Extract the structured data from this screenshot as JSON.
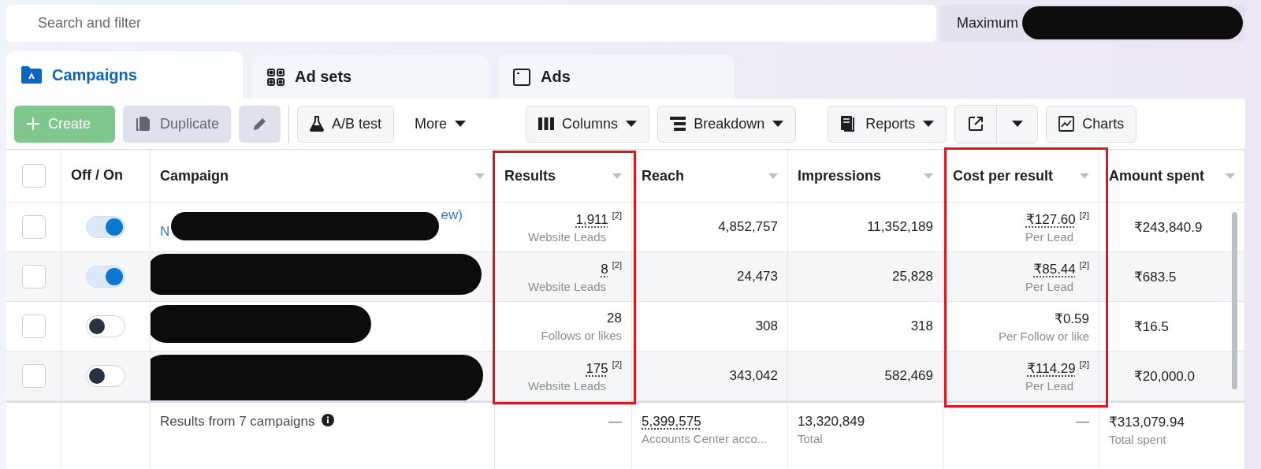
{
  "search": {
    "placeholder": "Search and filter"
  },
  "filter": {
    "label": "Maximum"
  },
  "tabs": [
    {
      "label": "Campaigns",
      "selected": true
    },
    {
      "label": "Ad sets",
      "selected": false
    },
    {
      "label": "Ads",
      "selected": false
    }
  ],
  "toolbar": [
    {
      "kind": "create",
      "label": "Create",
      "disabled": true
    },
    {
      "kind": "duplicate",
      "label": "Duplicate",
      "disabled": true
    },
    {
      "kind": "edit",
      "disabled": true
    },
    {
      "kind": "abtest",
      "label": "A/B test",
      "disabled": false
    },
    {
      "kind": "more",
      "label": "More",
      "disabled": false
    },
    {
      "kind": "columns",
      "label": "Columns",
      "disabled": false
    },
    {
      "kind": "breakdown",
      "label": "Breakdown",
      "disabled": false
    },
    {
      "kind": "reports",
      "label": "Reports",
      "disabled": false
    },
    {
      "kind": "export",
      "disabled": false
    },
    {
      "kind": "charts",
      "label": "Charts",
      "disabled": false
    }
  ],
  "table": {
    "all_checked": false,
    "columns": [
      {
        "label": "Off / On",
        "highlighted": false
      },
      {
        "label": "Campaign",
        "highlighted": false
      },
      {
        "label": "Results",
        "highlighted": true
      },
      {
        "label": "Reach",
        "highlighted": false
      },
      {
        "label": "Impressions",
        "highlighted": false
      },
      {
        "label": "Cost per result",
        "highlighted": true
      },
      {
        "label": "Amount spent",
        "highlighted": false
      }
    ],
    "rows": [
      {
        "checked": false,
        "on": true,
        "name_start": "N",
        "name_end": "ew)",
        "results": {
          "value": "1,911",
          "note": "[2]",
          "label": "Website Leads"
        },
        "reach": "4,852,757",
        "impressions": "11,352,189",
        "cost": {
          "value": "₹127.60",
          "note": "[2]",
          "label": "Per Lead"
        },
        "amount": "₹243,840.9"
      },
      {
        "checked": false,
        "on": true,
        "results": {
          "value": "8",
          "note": "[2]",
          "label": "Website Leads"
        },
        "reach": "24,473",
        "impressions": "25,828",
        "cost": {
          "value": "₹85.44",
          "note": "[2]",
          "label": "Per Lead"
        },
        "amount": "₹683.5"
      },
      {
        "checked": false,
        "on": false,
        "results": {
          "value": "28",
          "label": "Follows or likes"
        },
        "reach": "308",
        "impressions": "318",
        "cost": {
          "value": "₹0.59",
          "label": "Per Follow or like"
        },
        "amount": "₹16.5"
      },
      {
        "checked": false,
        "on": false,
        "results": {
          "value": "175",
          "note": "[2]",
          "label": "Website Leads"
        },
        "reach": "343,042",
        "impressions": "582,469",
        "cost": {
          "value": "₹114.29",
          "note": "[2]",
          "label": "Per Lead"
        },
        "amount": "₹20,000.0"
      }
    ],
    "footer": {
      "label": "Results from 7 campaigns",
      "results": "—",
      "reach": {
        "value": "5,399,575",
        "label": "Accounts Center acco..."
      },
      "impressions": {
        "value": "13,320,849",
        "label": "Total"
      },
      "cost": "—",
      "amount": {
        "value": "₹313,079.94",
        "label": "Total spent"
      }
    }
  }
}
